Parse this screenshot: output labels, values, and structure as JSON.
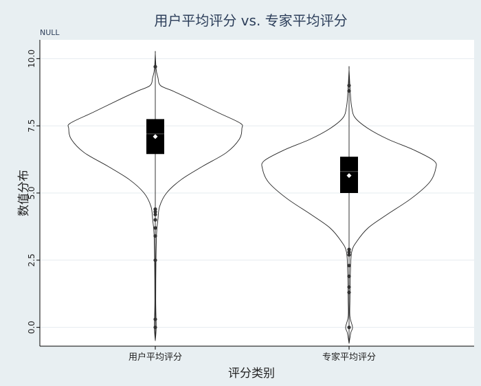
{
  "chart_data": {
    "type": "violin",
    "title": "用户平均评分 vs. 专家平均评分",
    "subtitle": "NULL",
    "xlabel": "评分类别",
    "ylabel": "数值分布",
    "ylim": [
      -0.7,
      10.7
    ],
    "yticks": [
      0.0,
      2.5,
      5.0,
      7.5,
      10.0
    ],
    "ytick_labels": [
      "0.0",
      "2.5",
      "5.0",
      "7.5",
      "10.0"
    ],
    "grid": true,
    "categories": [
      "用户平均评分",
      "专家平均评分"
    ],
    "series": [
      {
        "category": "用户平均评分",
        "min": -0.5,
        "max": 10.2,
        "q1": 6.45,
        "median": 7.2,
        "q3": 7.75,
        "mean": 7.1,
        "whisker_low": 4.5,
        "whisker_high": 9.5,
        "outliers": [
          0.0,
          0.3,
          2.5,
          3.4,
          3.7,
          4.0,
          4.2,
          4.3,
          4.4,
          9.7
        ],
        "density": [
          [
            -0.5,
            0.0
          ],
          [
            0.0,
            0.01
          ],
          [
            1.0,
            0.005
          ],
          [
            2.5,
            0.008
          ],
          [
            3.5,
            0.015
          ],
          [
            4.0,
            0.03
          ],
          [
            4.5,
            0.05
          ],
          [
            5.0,
            0.13
          ],
          [
            5.5,
            0.3
          ],
          [
            6.0,
            0.55
          ],
          [
            6.5,
            0.82
          ],
          [
            7.0,
            0.97
          ],
          [
            7.4,
            1.0
          ],
          [
            7.6,
            0.98
          ],
          [
            8.0,
            0.72
          ],
          [
            8.5,
            0.4
          ],
          [
            8.8,
            0.2
          ],
          [
            9.0,
            0.06
          ],
          [
            9.3,
            0.03
          ],
          [
            9.6,
            0.01
          ],
          [
            10.2,
            0.0
          ]
        ]
      },
      {
        "category": "专家平均评分",
        "min": -0.6,
        "max": 9.6,
        "q1": 5.0,
        "median": 5.8,
        "q3": 6.35,
        "mean": 5.65,
        "whisker_low": 3.0,
        "whisker_high": 8.3,
        "outliers": [
          0.0,
          1.3,
          1.5,
          1.9,
          2.3,
          2.7,
          2.8,
          2.9,
          8.8,
          9.0
        ],
        "density": [
          [
            -0.6,
            0.0
          ],
          [
            -0.2,
            0.02
          ],
          [
            0.0,
            0.04
          ],
          [
            0.4,
            0.01
          ],
          [
            1.0,
            0.01
          ],
          [
            2.0,
            0.015
          ],
          [
            2.8,
            0.03
          ],
          [
            3.2,
            0.09
          ],
          [
            3.7,
            0.22
          ],
          [
            4.2,
            0.44
          ],
          [
            4.8,
            0.72
          ],
          [
            5.4,
            0.93
          ],
          [
            5.9,
            1.0
          ],
          [
            6.2,
            0.98
          ],
          [
            6.6,
            0.75
          ],
          [
            7.0,
            0.45
          ],
          [
            7.4,
            0.22
          ],
          [
            7.8,
            0.07
          ],
          [
            8.2,
            0.03
          ],
          [
            8.7,
            0.015
          ],
          [
            9.6,
            0.0
          ]
        ]
      }
    ]
  }
}
